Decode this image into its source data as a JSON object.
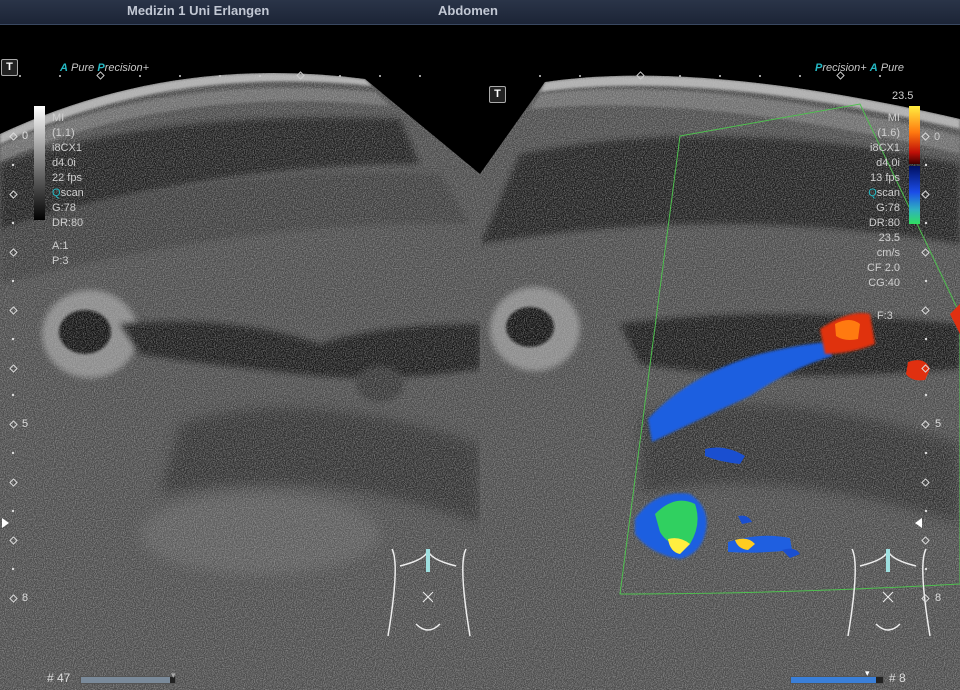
{
  "header": {
    "institution": "Medizin 1 Uni Erlangen",
    "exam": "Abdomen"
  },
  "logos": {
    "left_a": "A",
    "left_pure": "Pure",
    "left_p": "P",
    "left_precision": "recision",
    "left_plus": "+",
    "right_p": "P",
    "right_precision": "recision",
    "right_plus": "+",
    "right_a": "A",
    "right_pure": "Pure"
  },
  "t_button": "T",
  "left_params": {
    "mi": "MI",
    "mi_val": "(1.1)",
    "probe": "i8CX1",
    "depth": "d4.0i",
    "fps": "22 fps",
    "qscan_q": "Q",
    "qscan_rest": "scan",
    "gain": "G:78",
    "dr": "DR:80",
    "a": "A:1",
    "p": "P:3"
  },
  "right_params": {
    "scale_top": "23.5",
    "scale_zero": "0",
    "mi": "MI",
    "mi_val": "(1.6)",
    "probe": "i8CX1",
    "depth": "d4.0i",
    "fps": "13 fps",
    "qscan_q": "Q",
    "qscan_rest": "scan",
    "gain": "G:78",
    "dr": "DR:80",
    "vel": "23.5",
    "vel_unit": "cm/s",
    "cf": "CF 2.0",
    "cg": "CG:40",
    "f": "F:3"
  },
  "depth_scale": {
    "top": "0",
    "mid": "5",
    "bottom": "8"
  },
  "footer": {
    "left_frame": "# 47",
    "right_frame": "# 8",
    "left_progress": 0.95,
    "right_progress": 0.92
  },
  "colors": {
    "header_bg": "#1c2436",
    "accent": "#25b9c4",
    "doppler_red": "#e03010",
    "doppler_blue": "#1f5fe0",
    "doppler_green": "#30d060"
  }
}
